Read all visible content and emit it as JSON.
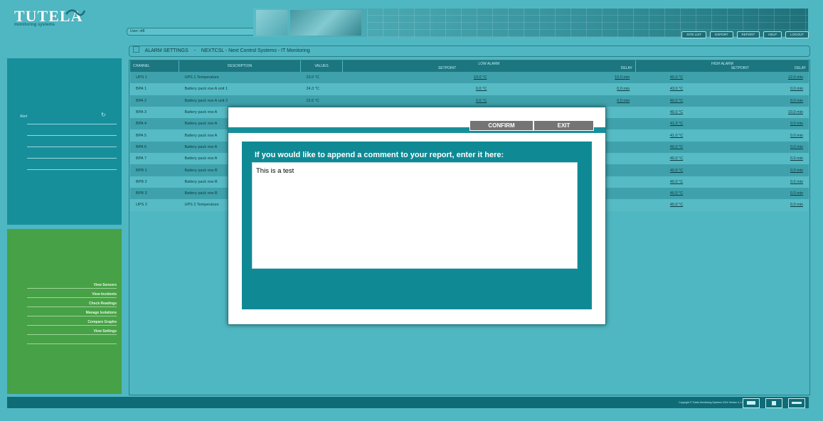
{
  "header": {
    "logo_text": "TUTELA",
    "logo_sub": "monitoring systems",
    "user_field": "User: nf8",
    "nav": [
      "SITE LIST",
      "EXPORT",
      "REPORT",
      "HELP",
      "LOGOUT"
    ]
  },
  "breadcrumb": {
    "section": "ALARM SETTINGS",
    "sep": "-",
    "site": "NEXTCSL - Next Control Systems - IT Monitoring"
  },
  "sidebar": {
    "alert_title": "Alert",
    "links": [
      "View Sensors",
      "View Incidents",
      "Check Readings",
      "Manage Isolations",
      "Compare Graphs",
      "View Settings"
    ]
  },
  "table": {
    "headers": {
      "channel": "CHANNEL",
      "description": "DESCRIPTION",
      "values": "VALUES",
      "low_alarm": "LOW ALARM",
      "high_alarm": "HIGH ALARM",
      "setpoint": "SETPOINT",
      "delay": "DELAY"
    },
    "rows": [
      {
        "channel": "UPS 1",
        "description": "UPS 1 Temperature",
        "value": "23.0 °C",
        "low_setpoint": "10.0 °C",
        "low_delay": "15.0 min",
        "high_setpoint": "40.0 °C",
        "high_delay": "12.0 min"
      },
      {
        "channel": "BPA 1",
        "description": "Battery pack row A unit 1",
        "value": "24.3 °C",
        "low_setpoint": "0.0 °C",
        "low_delay": "0.0 min",
        "high_setpoint": "43.0 °C",
        "high_delay": "0.0 min"
      },
      {
        "channel": "BPA 2",
        "description": "Battery pack row A unit 2",
        "value": "22.6 °C",
        "low_setpoint": "0.0 °C",
        "low_delay": "0.0 min",
        "high_setpoint": "40.0 °C",
        "high_delay": "0.0 min"
      },
      {
        "channel": "BPA 3",
        "description": "Battery pack row A",
        "value": "",
        "low_setpoint": "",
        "low_delay": "",
        "high_setpoint": "40.0 °C",
        "high_delay": "10.0 min"
      },
      {
        "channel": "BPA 4",
        "description": "Battery pack row A",
        "value": "",
        "low_setpoint": "",
        "low_delay": "",
        "high_setpoint": "41.0 °C",
        "high_delay": "0.0 min"
      },
      {
        "channel": "BPA 5",
        "description": "Battery pack row A",
        "value": "",
        "low_setpoint": "",
        "low_delay": "",
        "high_setpoint": "41.0 °C",
        "high_delay": "0.0 min"
      },
      {
        "channel": "BPA 6",
        "description": "Battery pack row A",
        "value": "",
        "low_setpoint": "",
        "low_delay": "",
        "high_setpoint": "40.0 °C",
        "high_delay": "0.0 min"
      },
      {
        "channel": "BPA 7",
        "description": "Battery pack row A",
        "value": "",
        "low_setpoint": "",
        "low_delay": "",
        "high_setpoint": "40.0 °C",
        "high_delay": "0.0 min"
      },
      {
        "channel": "BPB 1",
        "description": "Battery pack row B",
        "value": "",
        "low_setpoint": "",
        "low_delay": "",
        "high_setpoint": "40.0 °C",
        "high_delay": "0.0 min"
      },
      {
        "channel": "BPB 2",
        "description": "Battery pack row B",
        "value": "",
        "low_setpoint": "",
        "low_delay": "",
        "high_setpoint": "40.0 °C",
        "high_delay": "0.0 min"
      },
      {
        "channel": "BPB 3",
        "description": "Battery pack row B",
        "value": "",
        "low_setpoint": "",
        "low_delay": "",
        "high_setpoint": "40.0 °C",
        "high_delay": "0.0 min"
      },
      {
        "channel": "UPS 2",
        "description": "UPS 2 Temperature",
        "value": "",
        "low_setpoint": "",
        "low_delay": "",
        "high_setpoint": "40.0 °C",
        "high_delay": "0.0 min"
      }
    ]
  },
  "footer": {
    "copyright": "Copyright © Tutela Monitoring Systems 2016 Version 4.1.1"
  },
  "modal": {
    "confirm_label": "CONFIRM",
    "exit_label": "EXIT",
    "prompt": "If you would like to append a comment to your report, enter it here:",
    "comment_value": "This is a test"
  },
  "colors": {
    "background": "#4fb7c2",
    "header_dark": "#1b7680",
    "alert_panel": "#168f9b",
    "nav_panel": "#47a146",
    "modal_inner": "#0f8a95",
    "button_gray": "#747474"
  },
  "icons": [
    "refresh-icon",
    "settings-icon",
    "monitor-icon",
    "expand-icon",
    "minimize-icon"
  ]
}
